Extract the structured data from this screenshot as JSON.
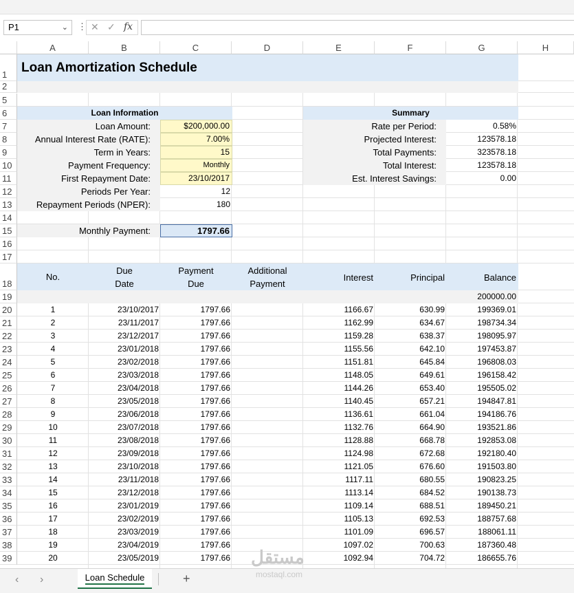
{
  "formula_bar": {
    "name_box": "P1",
    "fx": "fx",
    "formula": ""
  },
  "columns": [
    "A",
    "B",
    "C",
    "D",
    "E",
    "F",
    "G",
    "H"
  ],
  "rows": [
    "1",
    "2",
    "5",
    "6",
    "7",
    "8",
    "9",
    "10",
    "11",
    "12",
    "13",
    "14",
    "15",
    "16",
    "17",
    "18",
    "19",
    "20",
    "21",
    "22",
    "23",
    "24",
    "25",
    "26",
    "27",
    "28",
    "29",
    "30",
    "31",
    "32",
    "33",
    "34",
    "35",
    "36",
    "37",
    "38",
    "39"
  ],
  "title": "Loan Amortization Schedule",
  "loan_info": {
    "header": "Loan Information",
    "items": [
      {
        "label": "Loan Amount:",
        "value": "$200,000.00"
      },
      {
        "label": "Annual Interest Rate (RATE):",
        "value": "7.00%"
      },
      {
        "label": "Term in Years:",
        "value": "15"
      },
      {
        "label": "Payment Frequency:",
        "value": "Monthly"
      },
      {
        "label": "First Repayment Date:",
        "value": "23/10/2017"
      },
      {
        "label": "Periods Per Year:",
        "value": "12"
      },
      {
        "label": "Repayment Periods (NPER):",
        "value": "180"
      }
    ],
    "payment_label": "Monthly Payment:",
    "payment_value": "1797.66"
  },
  "summary": {
    "header": "Summary",
    "items": [
      {
        "label": "Rate per Period:",
        "value": "0.58%"
      },
      {
        "label": "Projected Interest:",
        "value": "123578.18"
      },
      {
        "label": "Total Payments:",
        "value": "323578.18"
      },
      {
        "label": "Total Interest:",
        "value": "123578.18"
      },
      {
        "label": "Est. Interest Savings:",
        "value": "0.00"
      }
    ]
  },
  "schedule": {
    "headers": {
      "no": "No.",
      "due_date_1": "Due",
      "due_date_2": "Date",
      "payment_due_1": "Payment",
      "payment_due_2": "Due",
      "additional_1": "Additional",
      "additional_2": "Payment",
      "interest": "Interest",
      "principal": "Principal",
      "balance": "Balance"
    },
    "opening_balance": "200000.00",
    "rows": [
      [
        "1",
        "23/10/2017",
        "1797.66",
        "",
        "1166.67",
        "630.99",
        "199369.01"
      ],
      [
        "2",
        "23/11/2017",
        "1797.66",
        "",
        "1162.99",
        "634.67",
        "198734.34"
      ],
      [
        "3",
        "23/12/2017",
        "1797.66",
        "",
        "1159.28",
        "638.37",
        "198095.97"
      ],
      [
        "4",
        "23/01/2018",
        "1797.66",
        "",
        "1155.56",
        "642.10",
        "197453.87"
      ],
      [
        "5",
        "23/02/2018",
        "1797.66",
        "",
        "1151.81",
        "645.84",
        "196808.03"
      ],
      [
        "6",
        "23/03/2018",
        "1797.66",
        "",
        "1148.05",
        "649.61",
        "196158.42"
      ],
      [
        "7",
        "23/04/2018",
        "1797.66",
        "",
        "1144.26",
        "653.40",
        "195505.02"
      ],
      [
        "8",
        "23/05/2018",
        "1797.66",
        "",
        "1140.45",
        "657.21",
        "194847.81"
      ],
      [
        "9",
        "23/06/2018",
        "1797.66",
        "",
        "1136.61",
        "661.04",
        "194186.76"
      ],
      [
        "10",
        "23/07/2018",
        "1797.66",
        "",
        "1132.76",
        "664.90",
        "193521.86"
      ],
      [
        "11",
        "23/08/2018",
        "1797.66",
        "",
        "1128.88",
        "668.78",
        "192853.08"
      ],
      [
        "12",
        "23/09/2018",
        "1797.66",
        "",
        "1124.98",
        "672.68",
        "192180.40"
      ],
      [
        "13",
        "23/10/2018",
        "1797.66",
        "",
        "1121.05",
        "676.60",
        "191503.80"
      ],
      [
        "14",
        "23/11/2018",
        "1797.66",
        "",
        "1117.11",
        "680.55",
        "190823.25"
      ],
      [
        "15",
        "23/12/2018",
        "1797.66",
        "",
        "1113.14",
        "684.52",
        "190138.73"
      ],
      [
        "16",
        "23/01/2019",
        "1797.66",
        "",
        "1109.14",
        "688.51",
        "189450.21"
      ],
      [
        "17",
        "23/02/2019",
        "1797.66",
        "",
        "1105.13",
        "692.53",
        "188757.68"
      ],
      [
        "18",
        "23/03/2019",
        "1797.66",
        "",
        "1101.09",
        "696.57",
        "188061.11"
      ],
      [
        "19",
        "23/04/2019",
        "1797.66",
        "",
        "1097.02",
        "700.63",
        "187360.48"
      ],
      [
        "20",
        "23/05/2019",
        "1797.66",
        "",
        "1092.94",
        "704.72",
        "186655.76"
      ]
    ]
  },
  "sheet_tabs": {
    "active": "Loan Schedule",
    "add": "+",
    "prev": "‹",
    "next": "›"
  },
  "watermark": {
    "arabic": "مستقل",
    "latin": "mostaql.com"
  },
  "colors": {
    "header_blue": "#ddeaf7",
    "input_yellow": "#fff9c9",
    "label_gray": "#f2f2f2",
    "excel_green": "#217346"
  }
}
